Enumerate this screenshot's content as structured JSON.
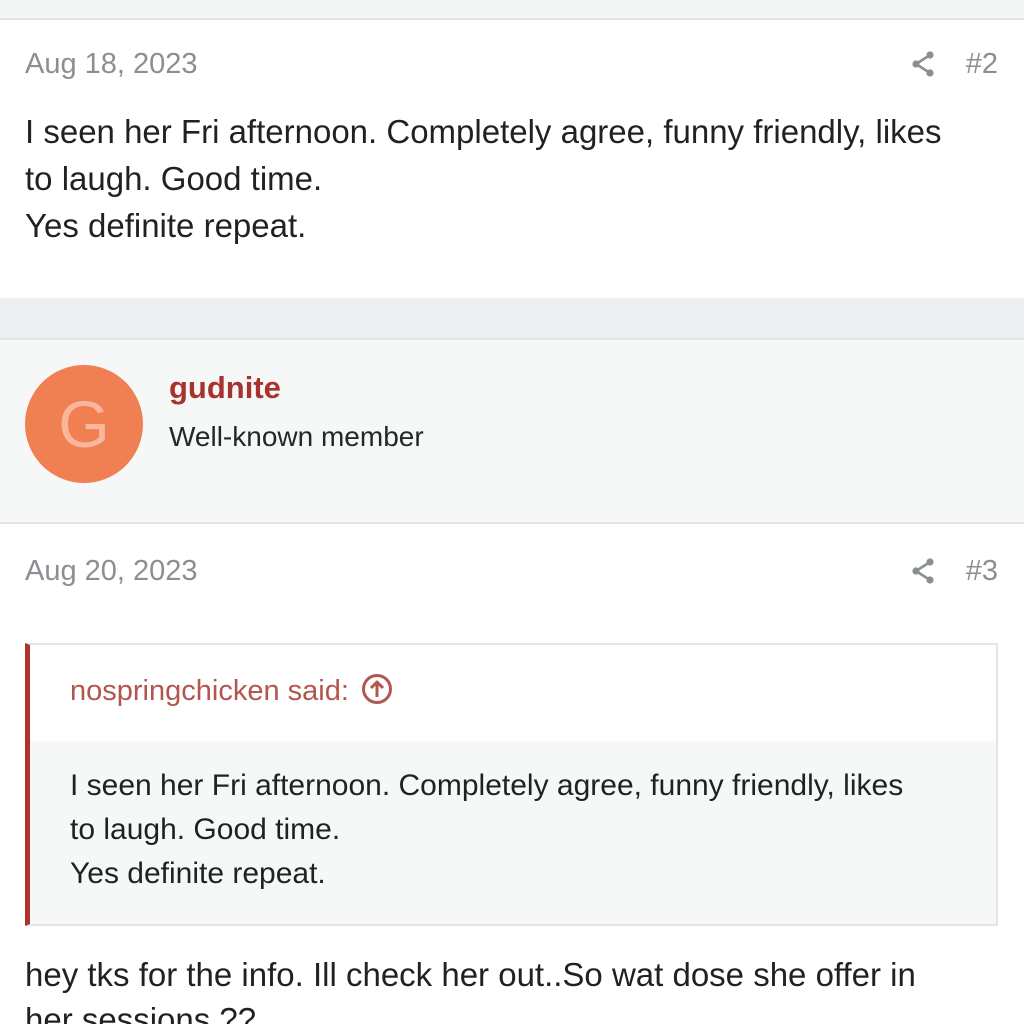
{
  "post1": {
    "date": "Aug 18, 2023",
    "number": "#2",
    "message_lines": [
      "I seen her Fri afternoon. Completely agree, funny friendly, likes",
      "to laugh. Good time.",
      "Yes definite repeat."
    ]
  },
  "post2": {
    "author": {
      "avatar_letter": "G",
      "avatar_color": "#f07f52",
      "username": "gudnite",
      "title": "Well-known member"
    },
    "date": "Aug 20, 2023",
    "number": "#3",
    "quote": {
      "author_label": "nospringchicken said:",
      "lines": [
        "I seen her Fri afternoon. Completely agree, funny friendly, likes",
        "to laugh. Good time.",
        "Yes definite repeat."
      ]
    },
    "message_lines": [
      "hey tks for the info. Ill check her out..So wat dose she offer in",
      "her sessions ??"
    ]
  },
  "icons": {
    "share": "share-icon",
    "jump_to_quote": "arrow-up-circle-icon"
  },
  "colors": {
    "username": "#a8322d",
    "quote_border": "#b0322b",
    "meta_text": "#8a8f93"
  }
}
